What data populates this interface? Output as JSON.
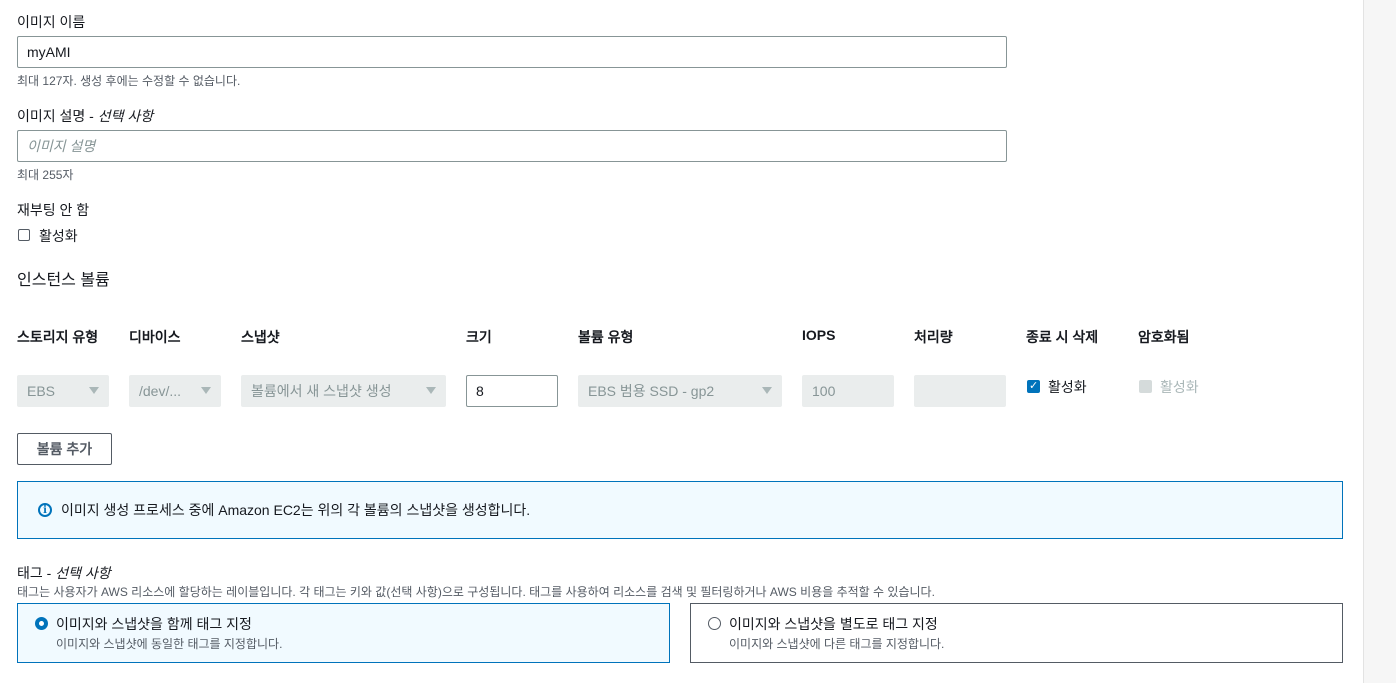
{
  "image_name": {
    "label": "이미지 이름",
    "value": "myAMI",
    "hint": "최대 127자. 생성 후에는 수정할 수 없습니다."
  },
  "image_description": {
    "label": "이미지 설명 - ",
    "label_optional": "선택 사항",
    "placeholder": "이미지 설명",
    "hint": "최대 255자"
  },
  "no_reboot": {
    "label": "재부팅 안 함",
    "checkbox_label": "활성화",
    "checked": false
  },
  "instance_volumes": {
    "title": "인스턴스 볼륨",
    "columns": [
      "스토리지 유형",
      "디바이스",
      "스냅샷",
      "크기",
      "볼륨 유형",
      "IOPS",
      "처리량",
      "종료 시 삭제",
      "암호화됨"
    ],
    "row": {
      "storage_type": "EBS",
      "device": "/dev/...",
      "snapshot": "볼륨에서 새 스냅샷 생성",
      "size": "8",
      "volume_type": "EBS 범용 SSD - gp2",
      "iops": "100",
      "throughput": "",
      "delete_on_termination_label": "활성화",
      "delete_on_termination": true,
      "encrypted_label": "활성화",
      "encrypted": false
    },
    "add_volume_label": "볼륨 추가"
  },
  "info_alert": {
    "icon": "info-icon",
    "text": "이미지 생성 프로세스 중에 Amazon EC2는 위의 각 볼륨의 스냅샷을 생성합니다.",
    "accent_color": "#0073bb"
  },
  "tags": {
    "label": "태그 - ",
    "label_optional": "선택 사항",
    "description": "태그는 사용자가 AWS 리소스에 할당하는 레이블입니다. 각 태그는 키와 값(선택 사항)으로 구성됩니다. 태그를 사용하여 리소스를 검색 및 필터링하거나 AWS 비용을 추적할 수 있습니다.",
    "options": [
      {
        "title": "이미지와 스냅샷을 함께 태그 지정",
        "description": "이미지와 스냅샷에 동일한 태그를 지정합니다.",
        "selected": true
      },
      {
        "title": "이미지와 스냅샷을 별도로 태그 지정",
        "description": "이미지와 스냅샷에 다른 태그를 지정합니다.",
        "selected": false
      }
    ]
  }
}
